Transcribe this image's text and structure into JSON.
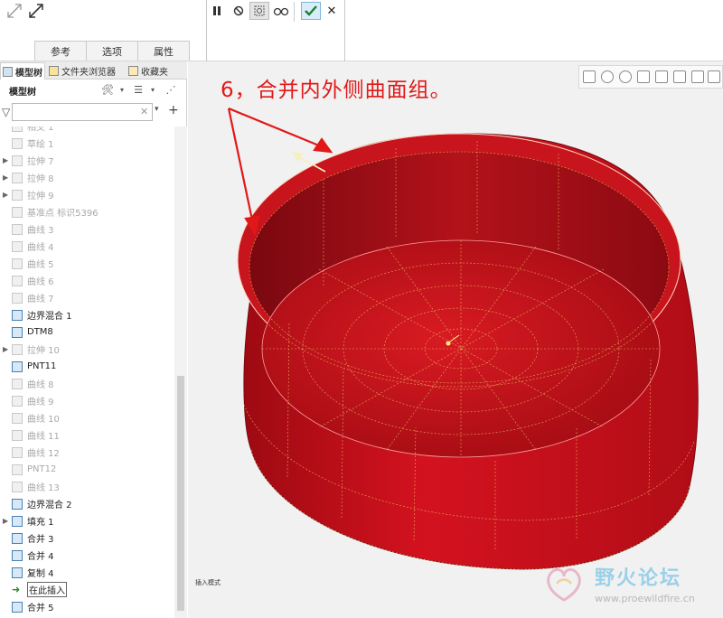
{
  "ribbon": {
    "tabs": [
      "参考",
      "选项",
      "属性"
    ],
    "controls": [
      "pause-icon",
      "stop-icon",
      "preview-icon",
      "glasses-icon",
      "confirm-icon",
      "cancel-icon"
    ],
    "cancel_glyph": "✕"
  },
  "panel": {
    "tabs": [
      "模型树",
      "文件夹浏览器",
      "收藏夹"
    ],
    "title": "模型树",
    "search_placeholder": "",
    "clear_glyph": "✕",
    "items": [
      {
        "label": "相交 1",
        "icon": "intersect-icon",
        "state": "grey",
        "arrow": false
      },
      {
        "label": "草绘 1",
        "icon": "sketch-icon",
        "state": "grey",
        "arrow": false
      },
      {
        "label": "拉伸 7",
        "icon": "extrude-icon",
        "state": "grey",
        "arrow": true
      },
      {
        "label": "拉伸 8",
        "icon": "extrude-icon",
        "state": "grey",
        "arrow": true
      },
      {
        "label": "拉伸 9",
        "icon": "extrude-icon",
        "state": "grey",
        "arrow": true
      },
      {
        "label": "基准点 标识5396",
        "icon": "datum-point-icon",
        "state": "grey",
        "arrow": false
      },
      {
        "label": "曲线 3",
        "icon": "curve-icon",
        "state": "grey",
        "arrow": false
      },
      {
        "label": "曲线 4",
        "icon": "curve-icon",
        "state": "grey",
        "arrow": false
      },
      {
        "label": "曲线 5",
        "icon": "curve-icon",
        "state": "grey",
        "arrow": false
      },
      {
        "label": "曲线 6",
        "icon": "curve-icon",
        "state": "grey",
        "arrow": false
      },
      {
        "label": "曲线 7",
        "icon": "curve-icon",
        "state": "grey",
        "arrow": false
      },
      {
        "label": "边界混合 1",
        "icon": "boundary-blend-icon",
        "state": "active",
        "arrow": false
      },
      {
        "label": "DTM8",
        "icon": "datum-plane-icon",
        "state": "active",
        "arrow": false
      },
      {
        "label": "拉伸 10",
        "icon": "extrude-icon",
        "state": "grey",
        "arrow": true
      },
      {
        "label": "PNT11",
        "icon": "datum-point-icon",
        "state": "active",
        "arrow": false
      },
      {
        "label": "曲线 8",
        "icon": "curve-icon",
        "state": "grey",
        "arrow": false
      },
      {
        "label": "曲线 9",
        "icon": "curve-icon",
        "state": "grey",
        "arrow": false
      },
      {
        "label": "曲线 10",
        "icon": "curve-icon",
        "state": "grey",
        "arrow": false
      },
      {
        "label": "曲线 11",
        "icon": "curve-icon",
        "state": "grey",
        "arrow": false
      },
      {
        "label": "曲线 12",
        "icon": "curve-icon",
        "state": "grey",
        "arrow": false
      },
      {
        "label": "PNT12",
        "icon": "datum-point-icon",
        "state": "grey",
        "arrow": false
      },
      {
        "label": "曲线 13",
        "icon": "curve-icon",
        "state": "grey",
        "arrow": false
      },
      {
        "label": "边界混合 2",
        "icon": "boundary-blend-icon",
        "state": "active",
        "arrow": false
      },
      {
        "label": "填充 1",
        "icon": "fill-icon",
        "state": "active",
        "arrow": true
      },
      {
        "label": "合并 3",
        "icon": "merge-icon",
        "state": "active",
        "arrow": false
      },
      {
        "label": "合并 4",
        "icon": "merge-icon",
        "state": "active",
        "arrow": false
      },
      {
        "label": "复制 4",
        "icon": "copy-icon",
        "state": "active",
        "arrow": false
      },
      {
        "label": "在此插入",
        "icon": "insert-here-icon",
        "state": "insert",
        "arrow": false
      },
      {
        "label": "合并 5",
        "icon": "merge-icon",
        "state": "active",
        "arrow": false
      }
    ]
  },
  "viewport": {
    "annotation": "6，合并内外侧曲面组。",
    "insert_note": "插入模式",
    "model_color": "#d4121f",
    "annotation_color": "#e21818",
    "watermark_title": "野火论坛",
    "watermark_url": "www.proewildfire.cn"
  }
}
